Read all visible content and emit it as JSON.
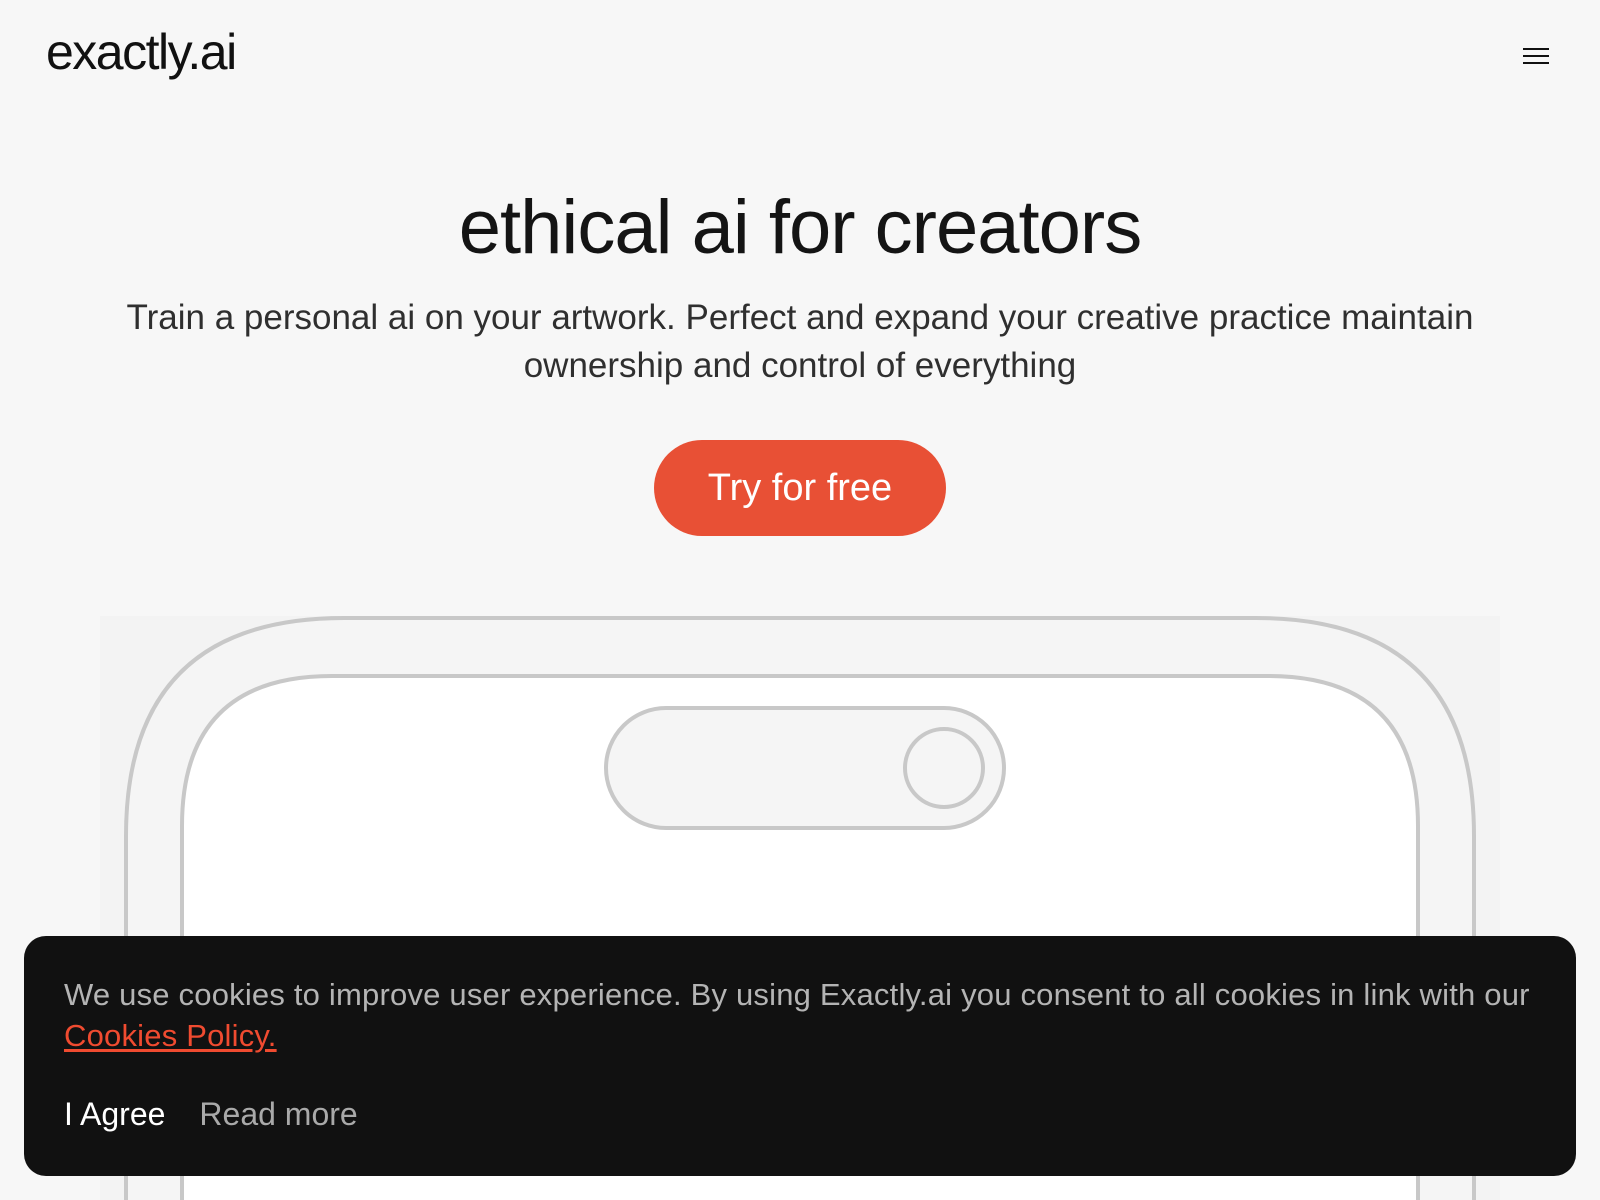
{
  "header": {
    "logo_text": "exactly.ai",
    "menu_icon": "hamburger-menu-icon"
  },
  "hero": {
    "title": "ethical ai for creators",
    "subtitle": "Train a personal ai on your artwork. Perfect and expand your creative practice maintain ownership and control of everything",
    "cta_label": "Try for free"
  },
  "cookie_banner": {
    "text_before_link": "We use cookies to improve user experience. By using Exactly.ai you consent to all cookies in link with our ",
    "link_label": "Cookies Policy.",
    "agree_label": "I Agree",
    "read_more_label": "Read more"
  },
  "colors": {
    "accent": "#e85035",
    "banner_background": "#111111",
    "page_background": "#f7f7f7",
    "link": "#f04b30"
  }
}
